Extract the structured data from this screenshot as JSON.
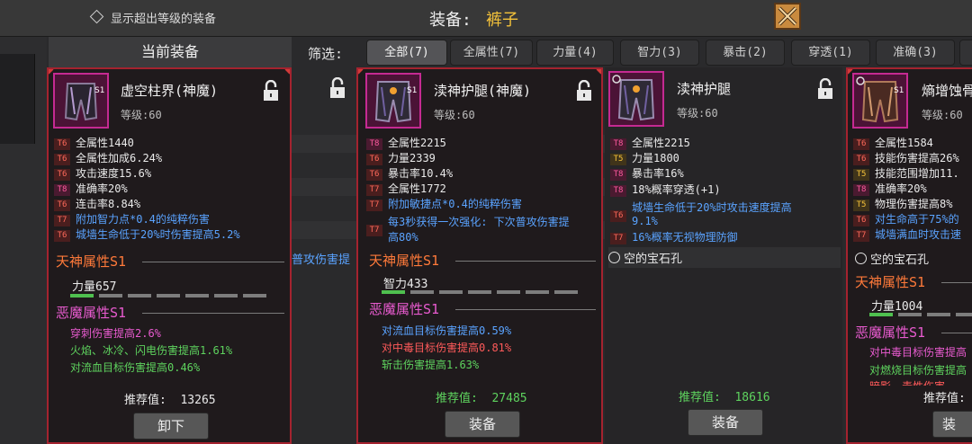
{
  "header": {
    "show_over_level_label": "显示超出等级的装备",
    "title_label": "装备:",
    "title_value": "裤子",
    "close_icon": "close-icon"
  },
  "current_header": "当前装备",
  "filter": {
    "label": "筛选:",
    "tabs": [
      {
        "label": "全部(7)",
        "active": true
      },
      {
        "label": "全属性(7)",
        "active": false
      },
      {
        "label": "力量(4)",
        "active": false
      },
      {
        "label": "智力(3)",
        "active": false
      },
      {
        "label": "暴击(2)",
        "active": false
      },
      {
        "label": "穿透(1)",
        "active": false
      },
      {
        "label": "准确(3)",
        "active": false
      }
    ]
  },
  "background_text": "普攻伤害提",
  "items": [
    {
      "name": "虚空柱界(神魔)",
      "level": "等级:60",
      "stats": [
        {
          "tier": "T6",
          "text": "全属性1440",
          "color": "w"
        },
        {
          "tier": "T6",
          "text": "全属性加成6.24%",
          "color": "w"
        },
        {
          "tier": "T6",
          "text": "攻击速度15.6%",
          "color": "w"
        },
        {
          "tier": "T8",
          "text": "准确率20%",
          "color": "w"
        },
        {
          "tier": "T6",
          "text": "连击率8.84%",
          "color": "w"
        },
        {
          "tier": "T7",
          "text": "附加智力点*0.4的纯粹伤害",
          "color": "b"
        },
        {
          "tier": "T6",
          "text": "城墙生命低于20%时伤害提高5.2%",
          "color": "b"
        }
      ],
      "heaven_title": "天神属性S1",
      "heaven_stat": "力量657",
      "demon_title": "恶魔属性S1",
      "demon_stats": [
        {
          "text": "穿刺伤害提高2.6%",
          "color": "p"
        },
        {
          "text": "火焰、冰冷、闪电伤害提高1.61%",
          "color": "g"
        },
        {
          "text": "对流血目标伤害提高0.46%",
          "color": "g"
        }
      ],
      "recommend_label": "推荐值:",
      "recommend_value": "13265",
      "button": "卸下"
    },
    {
      "name": "渎神护腿(神魔)",
      "level": "等级:60",
      "stats": [
        {
          "tier": "T8",
          "text": "全属性2215",
          "color": "w"
        },
        {
          "tier": "T6",
          "text": "力量2339",
          "color": "w"
        },
        {
          "tier": "T6",
          "text": "暴击率10.4%",
          "color": "w"
        },
        {
          "tier": "T7",
          "text": "全属性1772",
          "color": "w"
        },
        {
          "tier": "T7",
          "text": "附加敏捷点*0.4的纯粹伤害",
          "color": "b"
        },
        {
          "tier": "T7",
          "text": "每3秒获得一次强化: 下次普攻伤害提",
          "color": "b"
        },
        {
          "tier": "",
          "text": "高80%",
          "color": "b"
        }
      ],
      "heaven_title": "天神属性S1",
      "heaven_stat": "智力433",
      "demon_title": "恶魔属性S1",
      "demon_stats": [
        {
          "text": "对流血目标伤害提高0.59%",
          "color": "b"
        },
        {
          "text": "对中毒目标伤害提高0.81%",
          "color": "r"
        },
        {
          "text": "斩击伤害提高1.63%",
          "color": "g"
        }
      ],
      "recommend_label": "推荐值:",
      "recommend_value": "27485",
      "button": "装备"
    },
    {
      "name": "渎神护腿",
      "level": "等级:60",
      "stats": [
        {
          "tier": "T8",
          "text": "全属性2215",
          "color": "w"
        },
        {
          "tier": "T5",
          "text": "力量1800",
          "color": "w"
        },
        {
          "tier": "T8",
          "text": "暴击率16%",
          "color": "w"
        },
        {
          "tier": "T8",
          "text": "18%概率穿透(+1)",
          "color": "w"
        },
        {
          "tier": "T6",
          "text": "城墙生命低于20%时攻击速度提高",
          "color": "b"
        },
        {
          "tier": "",
          "text": "9.1%",
          "color": "b"
        },
        {
          "tier": "T7",
          "text": "16%概率无视物理防御",
          "color": "b"
        }
      ],
      "gem_slot": "空的宝石孔",
      "recommend_label": "推荐值:",
      "recommend_value": "18616",
      "button": "装备"
    },
    {
      "name": "熵增蚀骨",
      "level": "等级:60",
      "stats": [
        {
          "tier": "T6",
          "text": "全属性1584",
          "color": "w"
        },
        {
          "tier": "T6",
          "text": "技能伤害提高26%",
          "color": "w"
        },
        {
          "tier": "T5",
          "text": "技能范围增加11.",
          "color": "w"
        },
        {
          "tier": "T8",
          "text": "准确率20%",
          "color": "w"
        },
        {
          "tier": "T5",
          "text": "物理伤害提高8%",
          "color": "w"
        },
        {
          "tier": "T6",
          "text": "对生命高于75%的",
          "color": "b"
        },
        {
          "tier": "T7",
          "text": "城墙满血时攻击速",
          "color": "b"
        }
      ],
      "gem_slot": "空的宝石孔",
      "heaven_title": "天神属性S1",
      "heaven_stat": "力量1004",
      "demon_title": "恶魔属性S1",
      "demon_stats": [
        {
          "text": "对中毒目标伤害提高",
          "color": "r"
        },
        {
          "text": "对燃烧目标伤害提高",
          "color": "g"
        },
        {
          "text": "暗影、毒性伤害",
          "color": "r"
        }
      ],
      "recommend_label": "推荐值:",
      "button": "装"
    }
  ],
  "icons": [
    "diamond-icon",
    "close-icon",
    "lock-icon",
    "pants-icon",
    "gem-slot-icon"
  ]
}
